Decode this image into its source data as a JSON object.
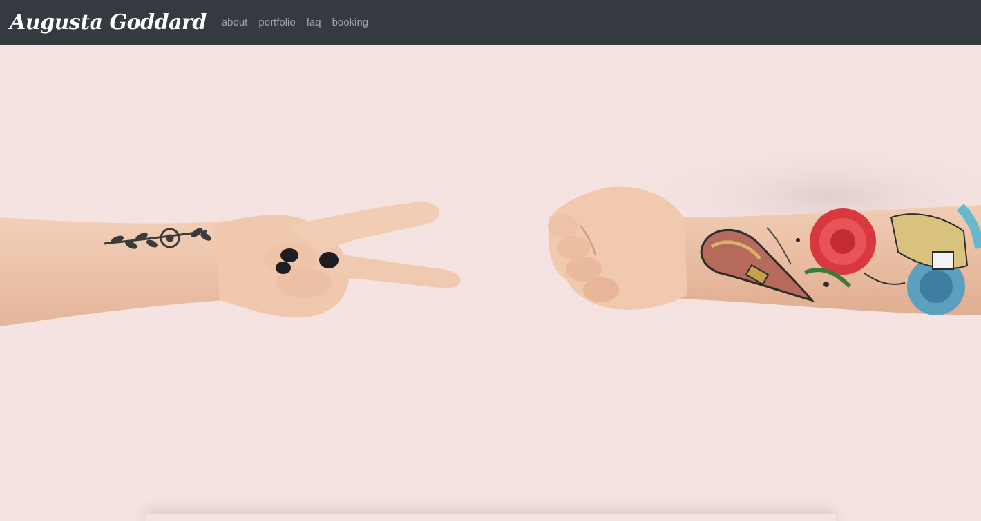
{
  "navbar": {
    "brand": "Augusta Goddard",
    "links": [
      {
        "label": "about"
      },
      {
        "label": "portfolio"
      },
      {
        "label": "faq"
      },
      {
        "label": "booking"
      }
    ]
  },
  "hero": {
    "left_hand": "peace-sign-hand",
    "right_hand": "fist-hand"
  },
  "colors": {
    "navbar_bg": "#343a40",
    "hero_bg": "#f4e3e1",
    "nav_link": "#9a9da0",
    "skin": "#efcbb2"
  }
}
